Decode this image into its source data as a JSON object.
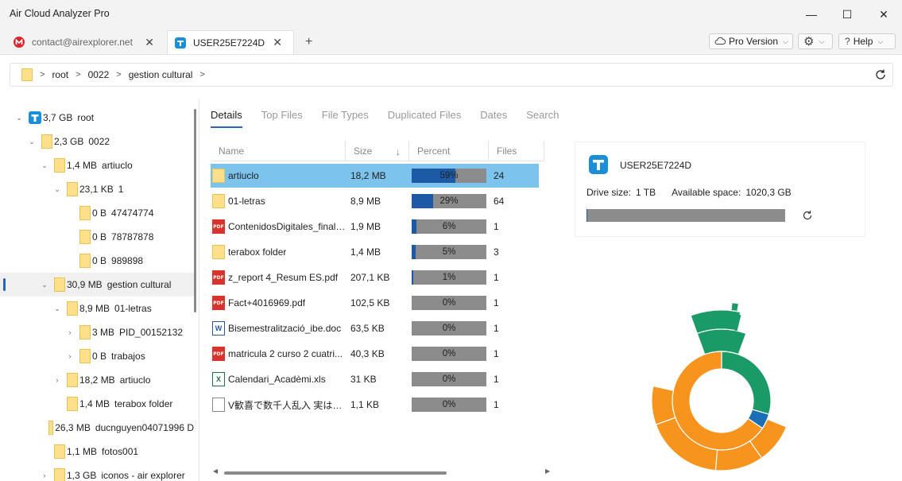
{
  "app": {
    "title": "Air Cloud Analyzer Pro",
    "window_controls": [
      "—",
      "☐",
      "✕"
    ]
  },
  "tabs": [
    {
      "label": "contact@airexplorer.net",
      "icon": "mega-icon",
      "active": false
    },
    {
      "label": "USER25E7224D",
      "icon": "cloud-drive-icon",
      "active": true
    }
  ],
  "toolbar": {
    "pro_label": "Pro Version",
    "help_label": "Help"
  },
  "breadcrumb": [
    "root",
    "0022",
    "gestion cultural"
  ],
  "tree": [
    {
      "size": "3,7 GB",
      "name": "root",
      "level": 0,
      "toggle": "⌄",
      "icon": "drive"
    },
    {
      "size": "2,3 GB",
      "name": "0022",
      "level": 1,
      "toggle": "⌄",
      "icon": "folder"
    },
    {
      "size": "1,4 MB",
      "name": "artiuclo",
      "level": 2,
      "toggle": "⌄",
      "icon": "folder"
    },
    {
      "size": "23,1 KB",
      "name": "1",
      "level": 3,
      "toggle": "⌄",
      "icon": "folder"
    },
    {
      "size": "0 B",
      "name": "47474774",
      "level": 4,
      "toggle": "",
      "icon": "folder"
    },
    {
      "size": "0 B",
      "name": "78787878",
      "level": 4,
      "toggle": "",
      "icon": "folder"
    },
    {
      "size": "0 B",
      "name": "989898",
      "level": 4,
      "toggle": "",
      "icon": "folder"
    },
    {
      "size": "30,9 MB",
      "name": "gestion cultural",
      "level": 2,
      "toggle": "⌄",
      "icon": "folder",
      "selected": true
    },
    {
      "size": "8,9 MB",
      "name": "01-letras",
      "level": 3,
      "toggle": "⌄",
      "icon": "folder"
    },
    {
      "size": "3 MB",
      "name": "PID_00152132",
      "level": 4,
      "toggle": "›",
      "icon": "folder"
    },
    {
      "size": "0 B",
      "name": "trabajos",
      "level": 4,
      "toggle": "›",
      "icon": "folder"
    },
    {
      "size": "18,2 MB",
      "name": "artiuclo",
      "level": 3,
      "toggle": "›",
      "icon": "folder"
    },
    {
      "size": "1,4 MB",
      "name": "terabox folder",
      "level": 3,
      "toggle": "",
      "icon": "folder"
    },
    {
      "size": "26,3 MB",
      "name": "ducnguyen04071996 D",
      "level": 2,
      "toggle": "",
      "icon": "folder"
    },
    {
      "size": "1,1 MB",
      "name": "fotos001",
      "level": 2,
      "toggle": "",
      "icon": "folder"
    },
    {
      "size": "1,3 GB",
      "name": "iconos - air explorer",
      "level": 2,
      "toggle": "›",
      "icon": "folder"
    }
  ],
  "section_tabs": [
    "Details",
    "Top Files",
    "File Types",
    "Duplicated Files",
    "Dates",
    "Search"
  ],
  "table": {
    "headers": {
      "name": "Name",
      "size": "Size",
      "percent": "Percent",
      "files": "Files"
    },
    "rows": [
      {
        "name": "artiuclo",
        "icon": "folder",
        "size": "18,2 MB",
        "percent": 59,
        "percent_label": "59%",
        "files": "24",
        "selected": true
      },
      {
        "name": "01-letras",
        "icon": "folder",
        "size": "8,9 MB",
        "percent": 29,
        "percent_label": "29%",
        "files": "64"
      },
      {
        "name": "ContenidosDigitales_final-...",
        "icon": "pdf",
        "size": "1,9 MB",
        "percent": 6,
        "percent_label": "6%",
        "files": "1"
      },
      {
        "name": "terabox folder",
        "icon": "folder",
        "size": "1,4 MB",
        "percent": 5,
        "percent_label": "5%",
        "files": "3"
      },
      {
        "name": "z_report 4_Resum ES.pdf",
        "icon": "pdf",
        "size": "207,1 KB",
        "percent": 1,
        "percent_label": "1%",
        "files": "1"
      },
      {
        "name": "Fact+4016969.pdf",
        "icon": "pdf",
        "size": "102,5 KB",
        "percent": 0,
        "percent_label": "0%",
        "files": "1"
      },
      {
        "name": "Bisemestralització_ibe.doc",
        "icon": "doc",
        "size": "63,5 KB",
        "percent": 0,
        "percent_label": "0%",
        "files": "1"
      },
      {
        "name": "matricula 2 curso 2 cuatri...",
        "icon": "pdf",
        "size": "40,3 KB",
        "percent": 0,
        "percent_label": "0%",
        "files": "1"
      },
      {
        "name": "Calendari_Acadèmi.xls",
        "icon": "xls",
        "size": "31 KB",
        "percent": 0,
        "percent_label": "0%",
        "files": "1"
      },
      {
        "name": "V歓喜で数千人乱入 実はV...",
        "icon": "txt",
        "size": "1,1 KB",
        "percent": 0,
        "percent_label": "0%",
        "files": "1"
      }
    ]
  },
  "drive": {
    "name": "USER25E7224D",
    "size_label": "Drive size:",
    "size_value": "1 TB",
    "available_label": "Available space:",
    "available_value": "1020,3 GB",
    "used_fraction": 0.004
  },
  "colors": {
    "accent": "#2a63b8",
    "selected_row": "#7cc3ed",
    "bar_fill": "#1c5aa6",
    "bar_bg": "#8c8c8c",
    "orange": "#f7941d",
    "green": "#1a9a66",
    "blue": "#1a6fb5"
  }
}
